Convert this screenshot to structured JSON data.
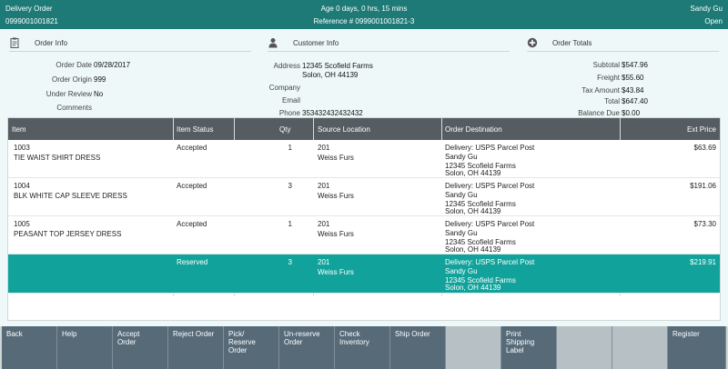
{
  "header": {
    "title": "Delivery Order",
    "order_number": "0999001001821",
    "age": "Age 0 days, 0 hrs, 15 mins",
    "reference": "Reference # 0999001001821-3",
    "user": "Sandy Gu",
    "status": "Open"
  },
  "order_info": {
    "title": "Order Info",
    "icon": "clipboard-icon",
    "fields": [
      {
        "label": "Order Date",
        "value": "09/28/2017"
      },
      {
        "label": "Order Origin",
        "value": "999"
      },
      {
        "label": "Under Review",
        "value": "No"
      },
      {
        "label": "Comments",
        "value": ""
      }
    ]
  },
  "customer_info": {
    "title": "Customer Info",
    "icon": "person-icon",
    "fields": [
      {
        "label": "Address",
        "value": "12345 Scofield Farms",
        "value2": "Solon, OH 44139"
      },
      {
        "label": "Company",
        "value": ""
      },
      {
        "label": "Email",
        "value": ""
      },
      {
        "label": "Phone",
        "value": "353432432432432"
      }
    ]
  },
  "order_totals": {
    "title": "Order Totals",
    "icon": "plus-circle-icon",
    "fields": [
      {
        "label": "Subtotal",
        "value": "$547.96"
      },
      {
        "label": "Freight",
        "value": "$55.60"
      },
      {
        "label": "Tax Amount",
        "value": "$43.84"
      },
      {
        "label": "Total",
        "value": "$647.40"
      },
      {
        "label": "Balance Due",
        "value": "$0.00"
      }
    ]
  },
  "table": {
    "columns": [
      "Item",
      "Item Status",
      "Qty",
      "Source Location",
      "Order Destination",
      "Ext Price"
    ],
    "rows": [
      {
        "item": "1003",
        "desc": "TIE WAIST SHIRT DRESS",
        "status": "Accepted",
        "qty": "1",
        "loc1": "201",
        "loc2": "Weiss Furs",
        "dest1": "Delivery: USPS Parcel Post",
        "dest2": "Sandy Gu",
        "dest3": "12345 Scofield Farms",
        "dest4": "Solon, OH 44139",
        "price": "$63.69",
        "selected": false
      },
      {
        "item": "1004",
        "desc": "BLK WHITE CAP SLEEVE DRESS",
        "status": "Accepted",
        "qty": "3",
        "loc1": "201",
        "loc2": "Weiss Furs",
        "dest1": "Delivery: USPS Parcel Post",
        "dest2": "Sandy Gu",
        "dest3": "12345 Scofield Farms",
        "dest4": "Solon, OH 44139",
        "price": "$191.06",
        "selected": false
      },
      {
        "item": "1005",
        "desc": "PEASANT TOP JERSEY DRESS",
        "status": "Accepted",
        "qty": "1",
        "loc1": "201",
        "loc2": "Weiss Furs",
        "dest1": "Delivery: USPS Parcel Post",
        "dest2": "Sandy Gu",
        "dest3": "12345 Scofield Farms",
        "dest4": "Solon, OH 44139",
        "price": "$73.30",
        "selected": false
      },
      {
        "item": "",
        "desc": "",
        "status": "Reserved",
        "qty": "3",
        "loc1": "201",
        "loc2": "Weiss Furs",
        "dest1": "Delivery: USPS Parcel Post",
        "dest2": "Sandy Gu",
        "dest3": "12345 Scofield Farms",
        "dest4": "Solon, OH 44139",
        "price": "$219.91",
        "selected": true
      }
    ]
  },
  "buttons": [
    {
      "label": "Back",
      "enabled": true
    },
    {
      "label": "Help",
      "enabled": true
    },
    {
      "label": "Accept\nOrder",
      "enabled": true
    },
    {
      "label": "Reject Order",
      "enabled": true
    },
    {
      "label": "Pick/\nReserve\nOrder",
      "enabled": true
    },
    {
      "label": "Un-reserve\nOrder",
      "enabled": true
    },
    {
      "label": "Check\nInventory",
      "enabled": true
    },
    {
      "label": "Ship Order",
      "enabled": true
    },
    {
      "label": "",
      "enabled": false
    },
    {
      "label": "Print\nShipping\nLabel",
      "enabled": true
    },
    {
      "label": "",
      "enabled": false
    },
    {
      "label": "",
      "enabled": false
    },
    {
      "label": "Register",
      "enabled": true
    }
  ],
  "colors": {
    "header_bg": "#1d7a76",
    "selected_row": "#11a39b",
    "button_bg": "#566a78",
    "table_header": "#555d63"
  }
}
